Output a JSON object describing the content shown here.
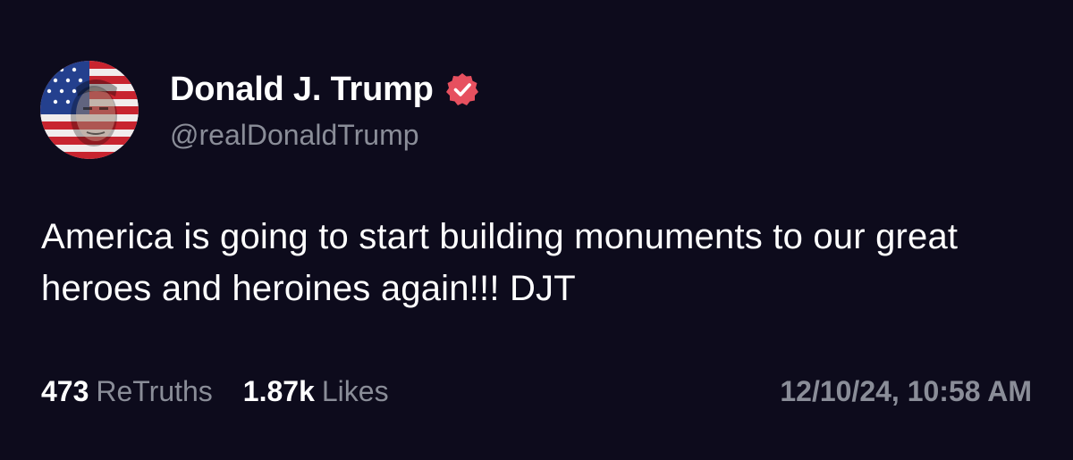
{
  "author": {
    "display_name": "Donald J. Trump",
    "handle": "@realDonaldTrump",
    "avatar_icon": "flag-portrait-avatar",
    "verified_icon": "verified-badge-icon",
    "verified_color": "#e6505f"
  },
  "post": {
    "text": "America is going to start building monuments to our great heroes and heroines again!!! DJT"
  },
  "stats": {
    "retruths_count": "473",
    "retruths_label": "ReTruths",
    "likes_count": "1.87k",
    "likes_label": "Likes",
    "timestamp": "12/10/24, 10:58 AM"
  },
  "colors": {
    "background": "#0d0b1c",
    "text": "#ffffff",
    "muted": "#8a8d98"
  }
}
